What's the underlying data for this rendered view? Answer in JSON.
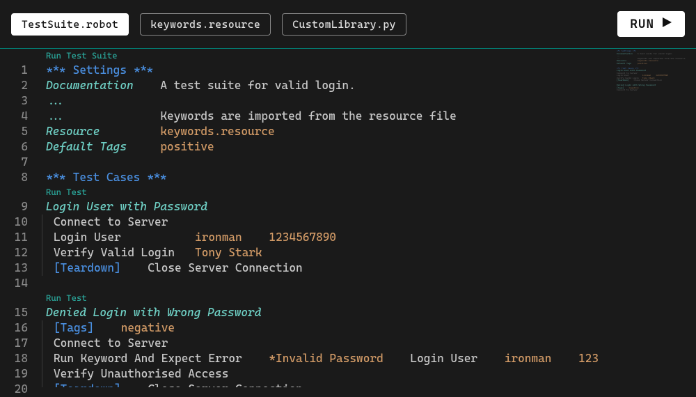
{
  "tabs": [
    {
      "label": "TestSuite.robot",
      "active": true
    },
    {
      "label": "keywords.resource",
      "active": false
    },
    {
      "label": "CustomLibrary.py",
      "active": false
    }
  ],
  "runButton": "RUN",
  "codeLens": {
    "runSuite": "Run Test Suite",
    "runTest": "Run Test"
  },
  "lines": [
    {
      "n": 1,
      "tokens": [
        {
          "t": "*** Settings ***",
          "c": "sec"
        }
      ]
    },
    {
      "n": 2,
      "tokens": [
        {
          "t": "Documentation",
          "c": "kw-def"
        },
        {
          "t": "    ",
          "c": ""
        },
        {
          "t": "A test suite for valid login.",
          "c": "gray"
        }
      ]
    },
    {
      "n": 3,
      "tokens": [
        {
          "t": "...",
          "c": "dots"
        }
      ]
    },
    {
      "n": 4,
      "tokens": [
        {
          "t": "...",
          "c": "dots"
        },
        {
          "t": "              ",
          "c": ""
        },
        {
          "t": "Keywords are imported from the resource file",
          "c": "gray"
        }
      ]
    },
    {
      "n": 5,
      "tokens": [
        {
          "t": "Resource",
          "c": "kw-def"
        },
        {
          "t": "         ",
          "c": ""
        },
        {
          "t": "keywords.resource",
          "c": "arg"
        }
      ]
    },
    {
      "n": 6,
      "tokens": [
        {
          "t": "Default Tags",
          "c": "kw-def"
        },
        {
          "t": "     ",
          "c": ""
        },
        {
          "t": "positive",
          "c": "arg"
        }
      ]
    },
    {
      "n": 7,
      "tokens": []
    },
    {
      "n": 8,
      "tokens": [
        {
          "t": "*** Test Cases ***",
          "c": "sec"
        }
      ]
    },
    {
      "n": 9,
      "tokens": [
        {
          "t": "Login User with Password",
          "c": "tc-name"
        }
      ],
      "lensBefore": "runTest"
    },
    {
      "n": 10,
      "indent": true,
      "tokens": [
        {
          "t": "Connect to Server",
          "c": "gray"
        }
      ]
    },
    {
      "n": 11,
      "indent": true,
      "tokens": [
        {
          "t": "Login User",
          "c": "gray"
        },
        {
          "t": "           ",
          "c": ""
        },
        {
          "t": "ironman",
          "c": "arg"
        },
        {
          "t": "    ",
          "c": ""
        },
        {
          "t": "1234567890",
          "c": "arg"
        }
      ]
    },
    {
      "n": 12,
      "indent": true,
      "tokens": [
        {
          "t": "Verify Valid Login",
          "c": "gray"
        },
        {
          "t": "   ",
          "c": ""
        },
        {
          "t": "Tony Stark",
          "c": "arg"
        }
      ]
    },
    {
      "n": 13,
      "indent": true,
      "tokens": [
        {
          "t": "[Teardown]",
          "c": "option"
        },
        {
          "t": "    ",
          "c": ""
        },
        {
          "t": "Close Server Connection",
          "c": "gray"
        }
      ]
    },
    {
      "n": 14,
      "tokens": []
    },
    {
      "n": 15,
      "tokens": [
        {
          "t": "Denied Login with Wrong Password",
          "c": "tc-name"
        }
      ],
      "lensBefore": "runTest"
    },
    {
      "n": 16,
      "indent": true,
      "tokens": [
        {
          "t": "[Tags]",
          "c": "option"
        },
        {
          "t": "    ",
          "c": ""
        },
        {
          "t": "negative",
          "c": "arg"
        }
      ]
    },
    {
      "n": 17,
      "indent": true,
      "tokens": [
        {
          "t": "Connect to Server",
          "c": "gray"
        }
      ]
    },
    {
      "n": 18,
      "indent": true,
      "tokens": [
        {
          "t": "Run Keyword And Expect Error",
          "c": "gray"
        },
        {
          "t": "    ",
          "c": ""
        },
        {
          "t": "*Invalid Password",
          "c": "arg"
        },
        {
          "t": "    ",
          "c": ""
        },
        {
          "t": "Login User",
          "c": "gray"
        },
        {
          "t": "    ",
          "c": ""
        },
        {
          "t": "ironman",
          "c": "arg"
        },
        {
          "t": "    ",
          "c": ""
        },
        {
          "t": "123",
          "c": "arg"
        }
      ]
    },
    {
      "n": 19,
      "indent": true,
      "tokens": [
        {
          "t": "Verify Unauthorised Access",
          "c": "gray"
        }
      ]
    },
    {
      "n": 20,
      "indent": true,
      "cut": true,
      "tokens": [
        {
          "t": "[Teardown]",
          "c": "option"
        },
        {
          "t": "    ",
          "c": ""
        },
        {
          "t": "Close Server Connection",
          "c": "gray"
        }
      ]
    }
  ]
}
